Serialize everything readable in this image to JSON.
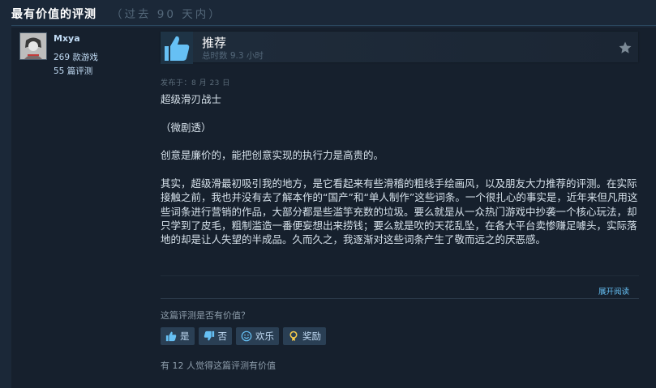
{
  "header": {
    "title": "最有价值的评测",
    "subtitle": "（过去 90 天内）"
  },
  "author": {
    "name": "Mxya",
    "games": "269 款游戏",
    "reviews": "55 篇评测"
  },
  "review": {
    "verdict": "推荐",
    "hours": "总时数 9.3 小时",
    "posted": "发布于：8 月 23 日",
    "paragraphs": [
      "超级滑刃战士",
      "（微剧透）",
      "创意是廉价的，能把创意实现的执行力是高贵的。",
      "其实，超级滑最初吸引我的地方，是它看起来有些滑稽的粗线手绘画风，以及朋友大力推荐的评测。在实际接触之前，我也并没有去了解本作的“国产”和“单人制作”这些词条。一个很扎心的事实是，近年来但凡用这些词条进行营销的作品，大部分都是些滥竽充数的垃圾。要么就是从一众热门游戏中抄袭一个核心玩法，却只学到了皮毛，粗制滥造一番便妄想出来捞钱；要么就是吹的天花乱坠，在各大平台卖惨赚足噱头，实际落地的却是让人失望的半成品。久而久之，我逐渐对这些词条产生了敬而远之的厌恶感。"
    ],
    "expand": "展开阅读"
  },
  "feedback": {
    "question": "这篇评测是否有价值？",
    "yes": "是",
    "no": "否",
    "funny": "欢乐",
    "award": "奖励",
    "helpful_count": "有 12 人觉得这篇评测有价值"
  },
  "colors": {
    "background": "#1b2838",
    "panel": "#16202d",
    "accent_link": "#66c0f4",
    "thumb": "#66c0f4",
    "button": "#2a3f54"
  },
  "icons": {
    "verdict": "thumbs-up-icon",
    "favorite": "star-icon",
    "yes": "thumbs-up-icon",
    "no": "thumbs-down-icon",
    "funny": "smiley-icon",
    "award": "award-icon"
  }
}
